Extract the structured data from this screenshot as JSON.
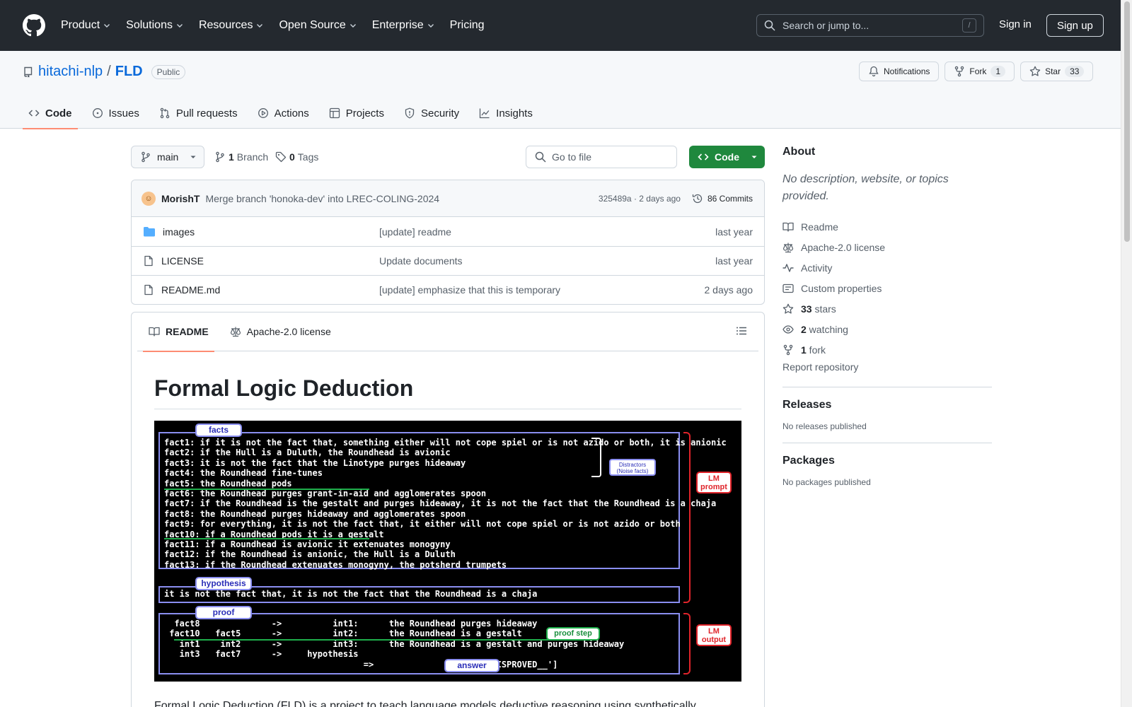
{
  "header": {
    "nav": [
      "Product",
      "Solutions",
      "Resources",
      "Open Source",
      "Enterprise",
      "Pricing"
    ],
    "search_placeholder": "Search or jump to...",
    "search_key": "/",
    "sign_in": "Sign in",
    "sign_up": "Sign up"
  },
  "repo": {
    "owner": "hitachi-nlp",
    "separator": "/",
    "name": "FLD",
    "visibility": "Public",
    "notifications_label": "Notifications",
    "fork_label": "Fork",
    "fork_count": "1",
    "star_label": "Star",
    "star_count": "33",
    "tabs": [
      "Code",
      "Issues",
      "Pull requests",
      "Actions",
      "Projects",
      "Security",
      "Insights"
    ]
  },
  "branchbar": {
    "branch": "main",
    "branch_count": "1",
    "branch_label": "Branch",
    "tag_count": "0",
    "tag_label": "Tags",
    "goto_placeholder": "Go to file",
    "code_button": "Code"
  },
  "latest_commit": {
    "author": "MorishT",
    "message": "Merge branch 'honoka-dev' into LREC-COLING-2024",
    "meta": "325489a · 2 days ago",
    "commits_label": "86 Commits"
  },
  "files": [
    {
      "type": "folder",
      "name": "images",
      "message": "[update] readme",
      "age": "last year"
    },
    {
      "type": "file",
      "name": "LICENSE",
      "message": "Update documents",
      "age": "last year"
    },
    {
      "type": "file",
      "name": "README.md",
      "message": "[update] emphasize that this is temporary",
      "age": "2 days ago"
    }
  ],
  "readme": {
    "tab_readme": "README",
    "tab_license": "Apache-2.0 license",
    "title": "Formal Logic Deduction",
    "intro": "Formal Logic Deduction (FLD) is a project to teach language models deductive reasoning using synthetically",
    "figure": {
      "facts_tag": "facts",
      "facts": [
        "fact1: if it is not the fact that, something either will not cope spiel or is not azido or both, it is anionic",
        "fact2: if the Hull is a Duluth, the Roundhead is avionic",
        "fact3: it is not the fact that the Linotype purges hideaway",
        "fact4: the Roundhead fine-tunes",
        "fact5: the Roundhead pods",
        "fact6: the Roundhead purges grant-in-aid and agglomerates spoon",
        "fact7: if the Roundhead is the gestalt and purges hideaway, it is not the fact that the Roundhead is a chaja",
        "fact8: the Roundhead purges hideaway and agglomerates spoon",
        "fact9: for everything, it is not the fact that, it either will not cope spiel or is not azido or both",
        "fact10: if a Roundhead pods it is a gestalt",
        "fact11: if a Roundhead is avionic it extenuates monogyny",
        "fact12: if the Roundhead is anionic, the Hull is a Duluth",
        "fact13: if the Roundhead extenuates monogyny, the potsherd trumpets"
      ],
      "distractors": "Distractors (Noise facts)",
      "lm_prompt": "LM prompt",
      "hypothesis_tag": "hypothesis",
      "hypothesis": "it is not the fact that, it is not the fact that the Roundhead is a chaja",
      "proof_tag": "proof",
      "proof": [
        "  fact8              ->          int1:      the Roundhead purges hideaway",
        " fact10   fact5      ->          int2:      the Roundhead is a gestalt",
        "   int1    int2      ->          int3:      the Roundhead is a gestalt and purges hideaway",
        "   int3   fact7      ->     hypothesis",
        "                                       =>                 = ['__DISPROVED__']"
      ],
      "proof_step": "proof step",
      "answer_tag": "answer",
      "lm_output": "LM output"
    }
  },
  "about": {
    "title": "About",
    "description": "No description, website, or topics provided.",
    "links": [
      {
        "icon": "book-icon",
        "bold": "",
        "text": "Readme"
      },
      {
        "icon": "scale-icon",
        "bold": "",
        "text": "Apache-2.0 license"
      },
      {
        "icon": "pulse-icon",
        "bold": "",
        "text": "Activity"
      },
      {
        "icon": "note-icon",
        "bold": "",
        "text": "Custom properties"
      },
      {
        "icon": "star-icon",
        "bold": "33",
        "text": " stars"
      },
      {
        "icon": "eye-icon",
        "bold": "2",
        "text": " watching"
      },
      {
        "icon": "fork-icon",
        "bold": "1",
        "text": " fork"
      }
    ],
    "report": "Report repository"
  },
  "releases": {
    "title": "Releases",
    "empty": "No releases published"
  },
  "packages": {
    "title": "Packages",
    "empty": "No packages published"
  }
}
